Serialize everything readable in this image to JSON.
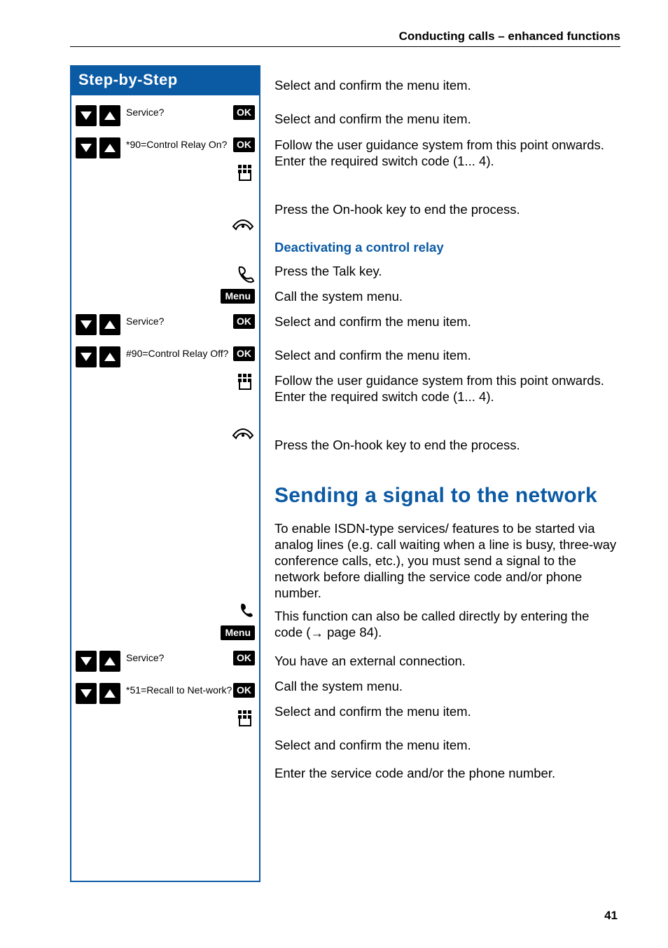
{
  "header": {
    "section_title": "Conducting calls – enhanced functions"
  },
  "sidebar": {
    "title": "Step-by-Step"
  },
  "labels": {
    "ok": "OK",
    "menu": "Menu"
  },
  "steps": {
    "service": "Service?",
    "relay_on": "*90=Control Relay On?",
    "relay_off": "#90=Control Relay Off?",
    "recall_net": "*51=Recall to Net-work?"
  },
  "instructions": {
    "select_confirm": "Select and confirm the menu item.",
    "follow_guidance": "Follow the user guidance system from this point onwards. Enter the required switch code (1... 4).",
    "press_onhook": "Press the On-hook key to end the process.",
    "deactivate_heading": "Deactivating a control relay",
    "press_talk": "Press the Talk key.",
    "call_menu": "Call the system menu.",
    "signal_heading": "Sending a signal to the network",
    "signal_para1": "To enable ISDN-type services/ features to be started via analog lines (e.g. call waiting when a line is busy, three-way conference calls, etc.), you must send a signal to the network before dialling the service code and/or phone number.",
    "signal_para2_a": "This function can also be called directly by entering the code (",
    "signal_para2_link": "page 84",
    "signal_para2_b": ").",
    "external_conn": "You have an external connection.",
    "enter_service_code": "Enter the service code and/or the phone number."
  },
  "page_number": "41"
}
